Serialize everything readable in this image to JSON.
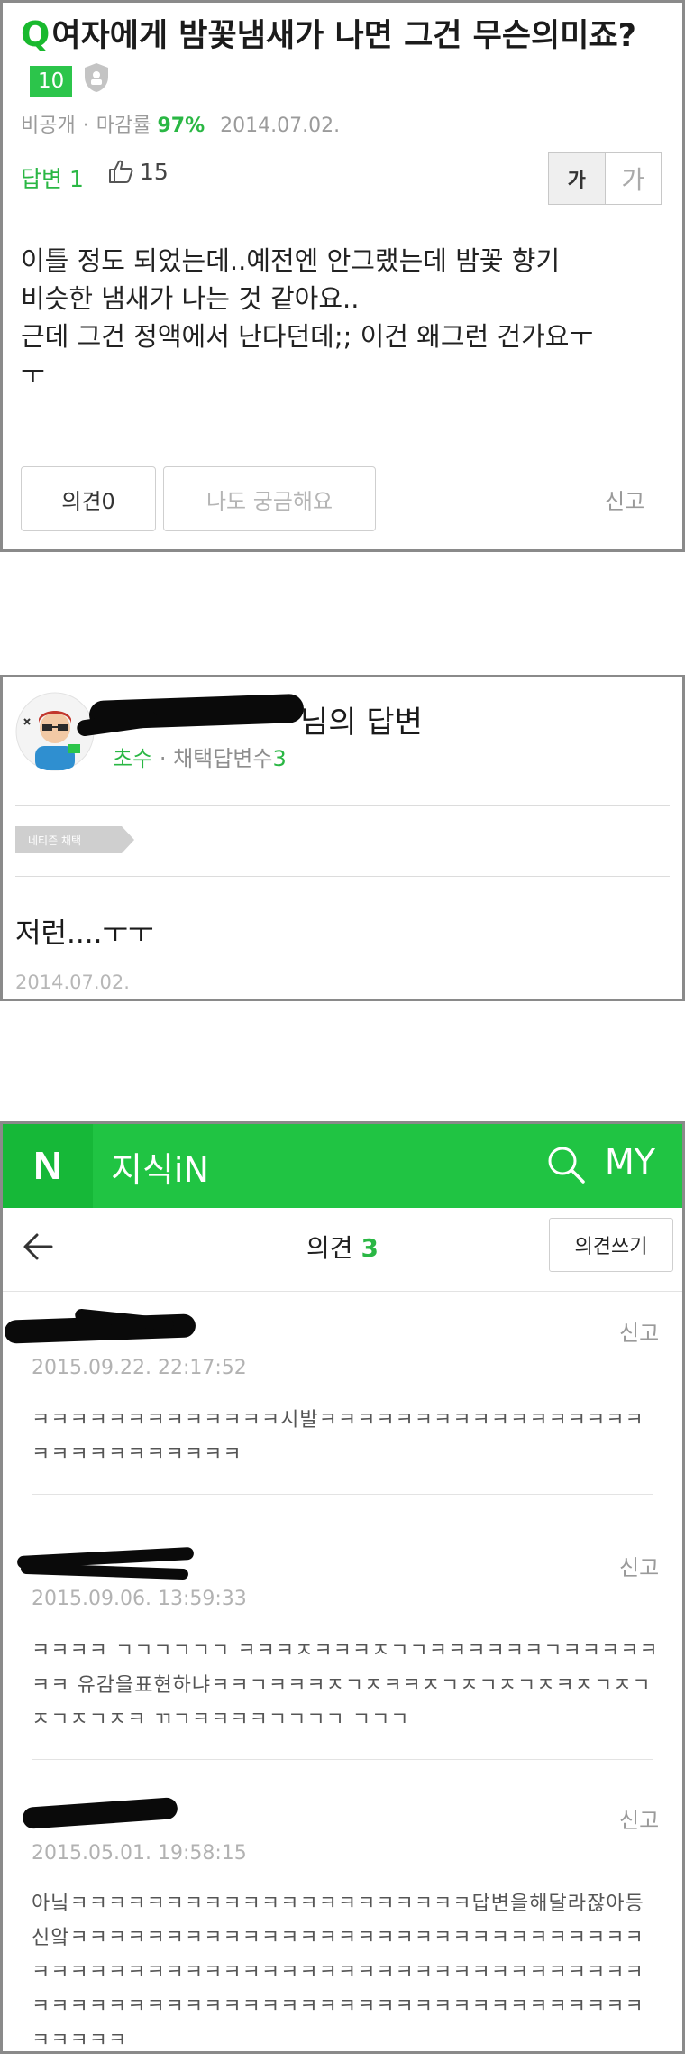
{
  "question": {
    "q_mark": "Q",
    "title": "여자에게 밤꽃냄새가 나면 그건 무슨의미죠?",
    "level_badge": "10",
    "meta": {
      "visibility": "비공개",
      "deadline_label": "마감률",
      "deadline_value": "97%",
      "date": "2014.07.02."
    },
    "answers_label": "답변 1",
    "likes": "15",
    "font_small": "가",
    "font_large": "가",
    "body_lines": [
      "이틀 정도 되었는데..예전엔 안그랬는데 밤꽃 향기",
      "비슷한 냄새가 나는 것 같아요..",
      "근데 그건 정액에서 난다던데;; 이건 왜그런 건가요ㅜ",
      "ㅜ"
    ],
    "opinion_button": "의견0",
    "curious_button": "나도 궁금해요",
    "report": "신고"
  },
  "answer": {
    "title_suffix": "님의 답변",
    "rank": "초수",
    "stats": "· 채택답변수",
    "stats_value": "3",
    "netizen_tag": "네티즌 채택",
    "text": "저런....ㅜㅜ",
    "date": "2014.07.02."
  },
  "opinions": {
    "logo": "N",
    "app_name": "지식iN",
    "my_label": "MY",
    "title": "의견",
    "count": "3",
    "write_button": "의견쓰기",
    "comments": [
      {
        "date": "2015.09.22. 22:17:52",
        "report": "신고",
        "body": "ㅋㅋㅋㅋㅋㅋㅋㅋㅋㅋㅋㅋㅋ시발ㅋㅋㅋㅋㅋㅋㅋㅋㅋㅋㅋㅋㅋㅋㅋㅋㅋㅋㅋㅋㅋㅋㅋㅋㅋㅋㅋㅋ"
      },
      {
        "date": "2015.09.06. 13:59:33",
        "report": "신고",
        "body": "ㅋㅋㅋㅋ ㄱㄱㄱㄱㄱㄱ ㅋㅋㅋㅈㅋㅋㅋㅈㄱㄱㅋㅋㅋㅋㅋㅋㄱㅋㅋㅋㅋㅋㅋㅋ 유감을표현하냐ㅋㅋㄱㅋㅋㅋㅈㄱㅈㅋㅋㅈㄱㅈㄱㅈㄱㅈㅋㅈㄱㅈㄱㅈㄱㅈㄱㅈㅋ ㄲㄱㅋㅋㅋㅋㄱㄱㄱㄱ ㄱㄱㄱ"
      },
      {
        "date": "2015.05.01. 19:58:15",
        "report": "신고",
        "body": "아닠ㅋㅋㅋㅋㅋㅋㅋㅋㅋㅋㅋㅋㅋㅋㅋㅋㅋㅋㅋㅋㅋ답변을해달라잖아등신앜ㅋㅋㅋㅋㅋㅋㅋㅋㅋㅋㅋㅋㅋㅋㅋㅋㅋㅋㅋㅋㅋㅋㅋㅋㅋㅋㅋㅋㅋㅋㅋㅋㅋㅋㅋㅋㅋㅋㅋㅋㅋㅋㅋㅋㅋㅋㅋㅋㅋㅋㅋㅋㅋㅋㅋㅋㅋㅋㅋㅋㅋㅋㅋㅋㅋㅋㅋㅋㅋㅋㅋㅋㅋㅋㅋㅋㅋㅋㅋㅋㅋㅋㅋㅋㅋㅋㅋㅋㅋㅋㅋㅋㅋㅋㅋㅋㅋㅋㅋ"
      }
    ]
  },
  "colors": {
    "accent_green": "#2ab744",
    "appbar_green": "#20c443",
    "border_gray": "#8a8a8a"
  }
}
